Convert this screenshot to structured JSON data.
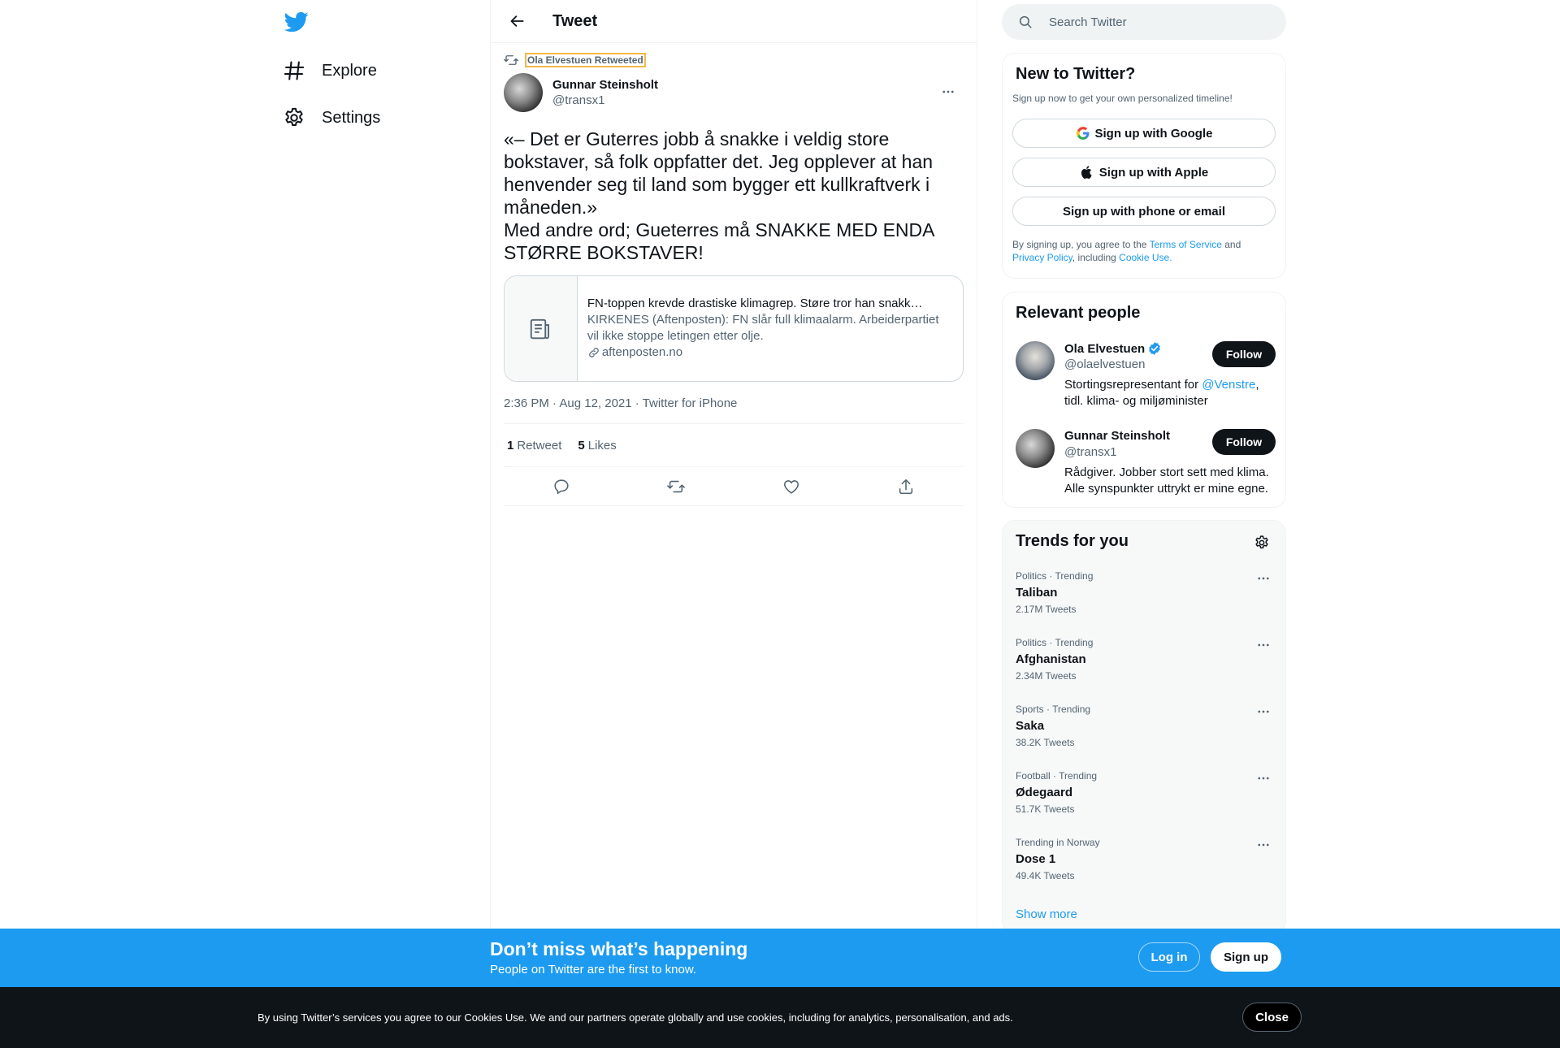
{
  "nav": {
    "logo_icon": "twitter-bird-icon",
    "items": [
      {
        "label": "Explore",
        "icon": "hashtag-icon"
      },
      {
        "label": "Settings",
        "icon": "gear-icon"
      }
    ]
  },
  "header": {
    "title": "Tweet",
    "back_icon": "arrow-left-icon"
  },
  "tweet": {
    "social_context": "Ola Elvestuen Retweeted",
    "author_name": "Gunnar Steinsholt",
    "author_handle": "@transx1",
    "text": "«– Det er Guterres jobb å snakke i veldig store bokstaver, så folk oppfatter det. Jeg opplever at han henvender seg til land som bygger ett kullkraftverk i måneden.»\nMed andre ord; Gueterres må SNAKKE MED ENDA STØRRE BOKSTAVER!",
    "card": {
      "title": "FN-toppen krevde drastiske klimagrep. Støre tror han snakker i store bokstaver",
      "description": "KIRKENES (Aftenposten): FN slår full klimaalarm. Arbeiderpartiet vil ikke stoppe letingen etter olje.",
      "domain": "aftenposten.no"
    },
    "timestamp": "2:36 PM · Aug 12, 2021 · Twitter for iPhone",
    "retweet_count": "1",
    "retweet_label": "Retweet",
    "like_count": "5",
    "like_label": "Likes"
  },
  "search": {
    "placeholder": "Search Twitter"
  },
  "new_to_twitter": {
    "title": "New to Twitter?",
    "subtitle": "Sign up now to get your own personalized timeline!",
    "google_label": "Sign up with Google",
    "apple_label": "Sign up with Apple",
    "phone_label": "Sign up with phone or email",
    "terms_prefix": "By signing up, you agree to the ",
    "terms_link": "Terms of Service",
    "terms_and": " and ",
    "privacy_link": "Privacy Policy",
    "terms_including": ", including ",
    "cookie_link": "Cookie Use."
  },
  "relevant_people": {
    "title": "Relevant people",
    "people": [
      {
        "name": "Ola Elvestuen",
        "handle": "@olaelvestuen",
        "bio_prefix": "Stortingsrepresentant for ",
        "bio_link": "@Venstre",
        "bio_suffix": ", tidl. klima- og miljøminister",
        "follow_label": "Follow",
        "verified": true
      },
      {
        "name": "Gunnar Steinsholt",
        "handle": "@transx1",
        "bio": "Rådgiver. Jobber stort sett med klima. Alle synspunkter uttrykt er mine egne.",
        "follow_label": "Follow"
      }
    ]
  },
  "trends": {
    "title": "Trends for you",
    "items": [
      {
        "category": "Politics · Trending",
        "name": "Taliban",
        "count": "2.17M Tweets"
      },
      {
        "category": "Politics · Trending",
        "name": "Afghanistan",
        "count": "2.34M Tweets"
      },
      {
        "category": "Sports · Trending",
        "name": "Saka",
        "count": "38.2K Tweets"
      },
      {
        "category": "Football · Trending",
        "name": "Ødegaard",
        "count": "51.7K Tweets"
      },
      {
        "category": "Trending in Norway",
        "name": "Dose 1",
        "count": "49.4K Tweets"
      }
    ],
    "show_more": "Show more"
  },
  "banner": {
    "title": "Don’t miss what’s happening",
    "subtitle": "People on Twitter are the first to know.",
    "login_label": "Log in",
    "signup_label": "Sign up"
  },
  "cookie_bar": {
    "text": "By using Twitter’s services you agree to our Cookies Use. We and our partners operate globally and use cookies, including for analytics, personalisation, and ads.",
    "close_label": "Close"
  },
  "colors": {
    "accent": "#1d9bf0",
    "text_primary": "#0f1419",
    "text_secondary": "#536471",
    "border": "#eff3f4"
  }
}
